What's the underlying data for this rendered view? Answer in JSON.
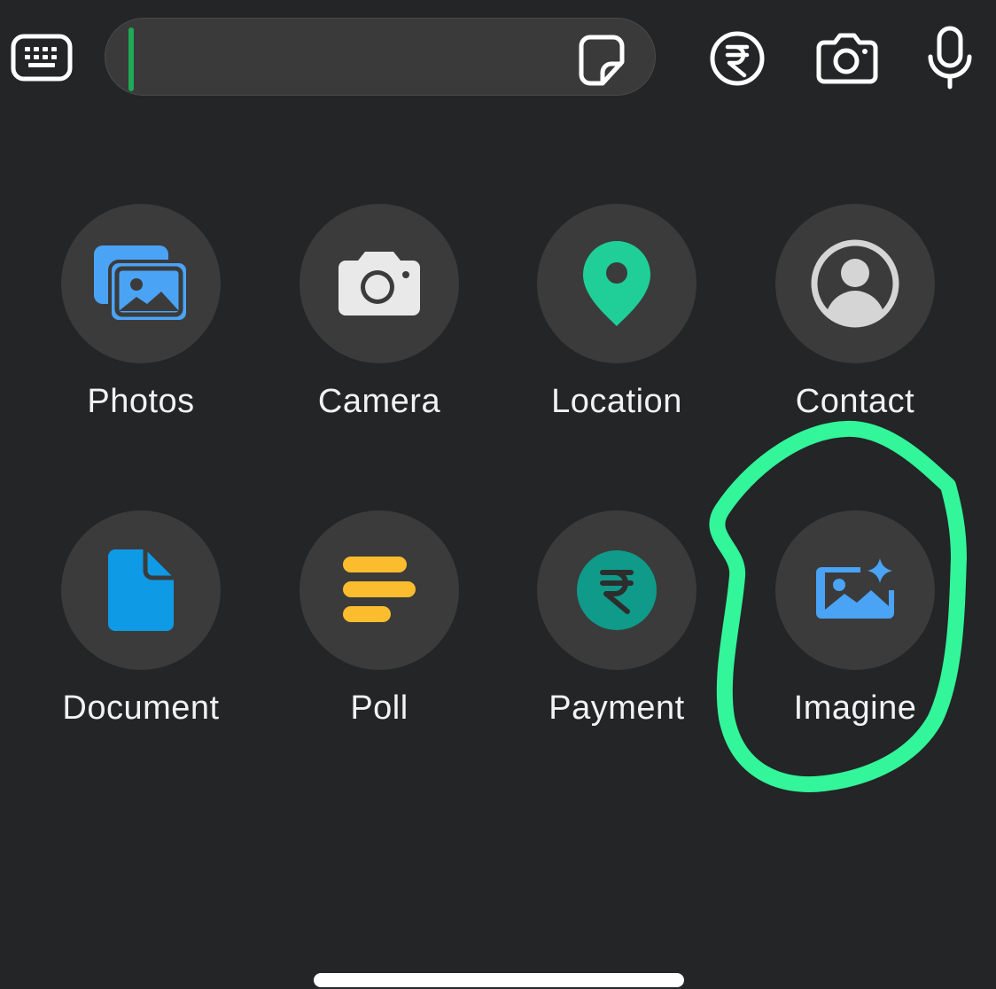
{
  "composer": {
    "keyboard_icon": "keyboard-icon",
    "sticker_icon": "sticker-icon",
    "payment_icon": "rupee-circle-icon",
    "camera_icon": "camera-icon",
    "mic_icon": "microphone-icon",
    "caret_color": "#1fa855"
  },
  "attachments": [
    {
      "label": "Photos",
      "icon": "photos-icon",
      "color": "#4aa3f5"
    },
    {
      "label": "Camera",
      "icon": "camera-icon",
      "color": "#e9e9e9"
    },
    {
      "label": "Location",
      "icon": "location-pin-icon",
      "color": "#1fcf97"
    },
    {
      "label": "Contact",
      "icon": "contact-icon",
      "color": "#d5d5d5"
    },
    {
      "label": "Document",
      "icon": "document-icon",
      "color": "#0f9ae6"
    },
    {
      "label": "Poll",
      "icon": "poll-icon",
      "color": "#fbbd2e"
    },
    {
      "label": "Payment",
      "icon": "rupee-icon",
      "color": "#0f9a8a"
    },
    {
      "label": "Imagine",
      "icon": "imagine-icon",
      "color": "#4aa3f5"
    }
  ],
  "annotation": {
    "color": "#33f59a",
    "shape": "hand-drawn circle around Imagine"
  }
}
